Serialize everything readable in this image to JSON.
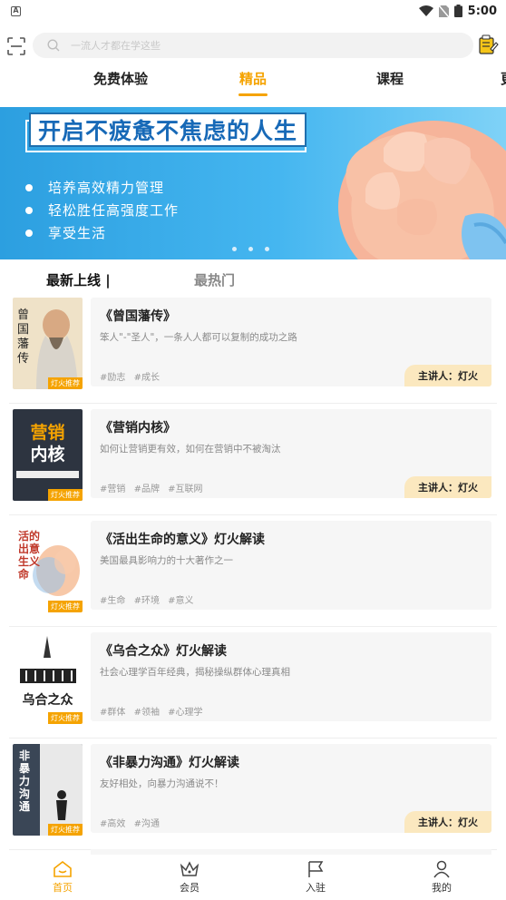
{
  "status_bar": {
    "time": "5:00"
  },
  "search": {
    "placeholder": "一流人才都在学这些"
  },
  "tabs": [
    {
      "label": "免费体验",
      "active": false
    },
    {
      "label": "精品",
      "active": true
    },
    {
      "label": "课程",
      "active": false
    }
  ],
  "banner": {
    "title": "开启不疲惫不焦虑的人生",
    "bullets": [
      "培养高效精力管理",
      "轻松胜任高强度工作",
      "享受生活"
    ]
  },
  "section_tabs": [
    {
      "label": "最新上线 |",
      "active": true
    },
    {
      "label": "最热门",
      "active": false
    }
  ],
  "courses": [
    {
      "title": "《曾国藩传》",
      "desc": "笨人\"-\"圣人\"，一条人人都可以复制的成功之路",
      "tags": [
        "#励志",
        "#成长"
      ],
      "speaker": "主讲人：灯火",
      "cover_tag": "灯火推荐",
      "cover_text": "曾国藩传"
    },
    {
      "title": "《营销内核》",
      "desc": "如何让营销更有效，如何在营销中不被淘汰",
      "tags": [
        "#营销",
        "#品牌",
        "#互联网"
      ],
      "speaker": "主讲人：灯火",
      "cover_tag": "灯火推荐",
      "cover_text": "营销内核"
    },
    {
      "title": "《活出生命的意义》灯火解读",
      "desc": "美国最具影响力的十大著作之一",
      "tags": [
        "#生命",
        "#环境",
        "#意义"
      ],
      "speaker": "",
      "cover_tag": "灯火推荐",
      "cover_text": "活出生命的意义"
    },
    {
      "title": "《乌合之众》灯火解读",
      "desc": "社会心理学百年经典，揭秘操纵群体心理真相",
      "tags": [
        "#群体",
        "#领袖",
        "#心理学"
      ],
      "speaker": "",
      "cover_tag": "灯火推荐",
      "cover_text": "乌合之众"
    },
    {
      "title": "《非暴力沟通》灯火解读",
      "desc": "友好相处，向暴力沟通说不！",
      "tags": [
        "#高效",
        "#沟通"
      ],
      "speaker": "主讲人：灯火",
      "cover_tag": "灯火推荐",
      "cover_text": "非暴力沟通"
    }
  ],
  "bottom_nav": [
    {
      "label": "首页",
      "icon": "home-icon",
      "active": true
    },
    {
      "label": "会员",
      "icon": "crown-icon",
      "active": false
    },
    {
      "label": "入驻",
      "icon": "flag-icon",
      "active": false
    },
    {
      "label": "我的",
      "icon": "user-icon",
      "active": false
    }
  ],
  "colors": {
    "accent": "#f5a300",
    "banner": "#2c9fe0",
    "speaker_bg": "#fbe8bf"
  }
}
